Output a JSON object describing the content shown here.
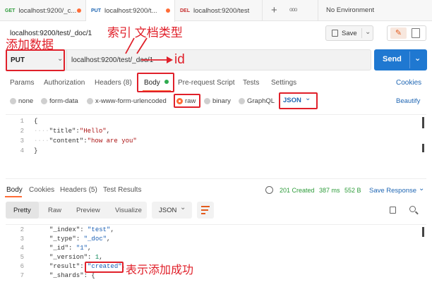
{
  "tabs": [
    {
      "method": "GET",
      "title": "localhost:9200/_c...",
      "method_color": "#2e9c3b",
      "unsaved": true
    },
    {
      "method": "PUT",
      "title": "localhost:9200/t...",
      "method_color": "#1f66b3",
      "unsaved": true
    },
    {
      "method": "DEL",
      "title": "localhost:9200/test",
      "method_color": "#c62d2d",
      "unsaved": false
    }
  ],
  "tab_add": "+",
  "tab_more": "ooo",
  "environment": "No Environment",
  "request_title": "localhost:9200/test/_doc/1",
  "save_label": "Save",
  "method": "PUT",
  "url": "localhost:9200/test/_doc/1",
  "send_label": "Send",
  "request_tabs": {
    "params": "Params",
    "authorization": "Authorization",
    "headers": "Headers (8)",
    "body": "Body",
    "prerequest": "Pre-request Script",
    "tests": "Tests",
    "settings": "Settings",
    "cookies": "Cookies"
  },
  "body_types": {
    "none": "none",
    "form_data": "form-data",
    "urlencoded": "x-www-form-urlencoded",
    "raw": "raw",
    "binary": "binary",
    "graphql": "GraphQL",
    "format": "JSON",
    "beautify": "Beautify"
  },
  "request_body": {
    "l1": "{",
    "l2_key": "\"title\"",
    "l2_val": "\"Hello\"",
    "l3_key": "\"content\"",
    "l3_val": "\"how are you\"",
    "l4": "}"
  },
  "response_tabs": {
    "body": "Body",
    "cookies": "Cookies",
    "headers": "Headers (5)",
    "test_results": "Test Results"
  },
  "response_meta": {
    "status": "201 Created",
    "time": "387 ms",
    "size": "552 B",
    "save_response": "Save Response"
  },
  "view_modes": {
    "pretty": "Pretty",
    "raw": "Raw",
    "preview": "Preview",
    "visualize": "Visualize",
    "format": "JSON"
  },
  "response_body": {
    "l2_key": "\"_index\"",
    "l2_val": "\"test\"",
    "l3_key": "\"_type\"",
    "l3_val": "\"_doc\"",
    "l4_key": "\"_id\"",
    "l4_val": "\"1\"",
    "l5_key": "\"_version\"",
    "l5_val": "1",
    "l6_key": "\"result\"",
    "l6_val": "\"created\"",
    "l7_key": "\"_shards\"",
    "l7_val": "{"
  },
  "annotations": {
    "add_data": "添加数据",
    "index_doctype": "索引 文档类型",
    "id": "id",
    "created_meaning": "表示添加成功"
  },
  "colors": {
    "accent_orange": "#ff6c37",
    "send_blue": "#1f78d1",
    "annotation_red": "#e0202a",
    "status_green": "#2e9c3b"
  }
}
